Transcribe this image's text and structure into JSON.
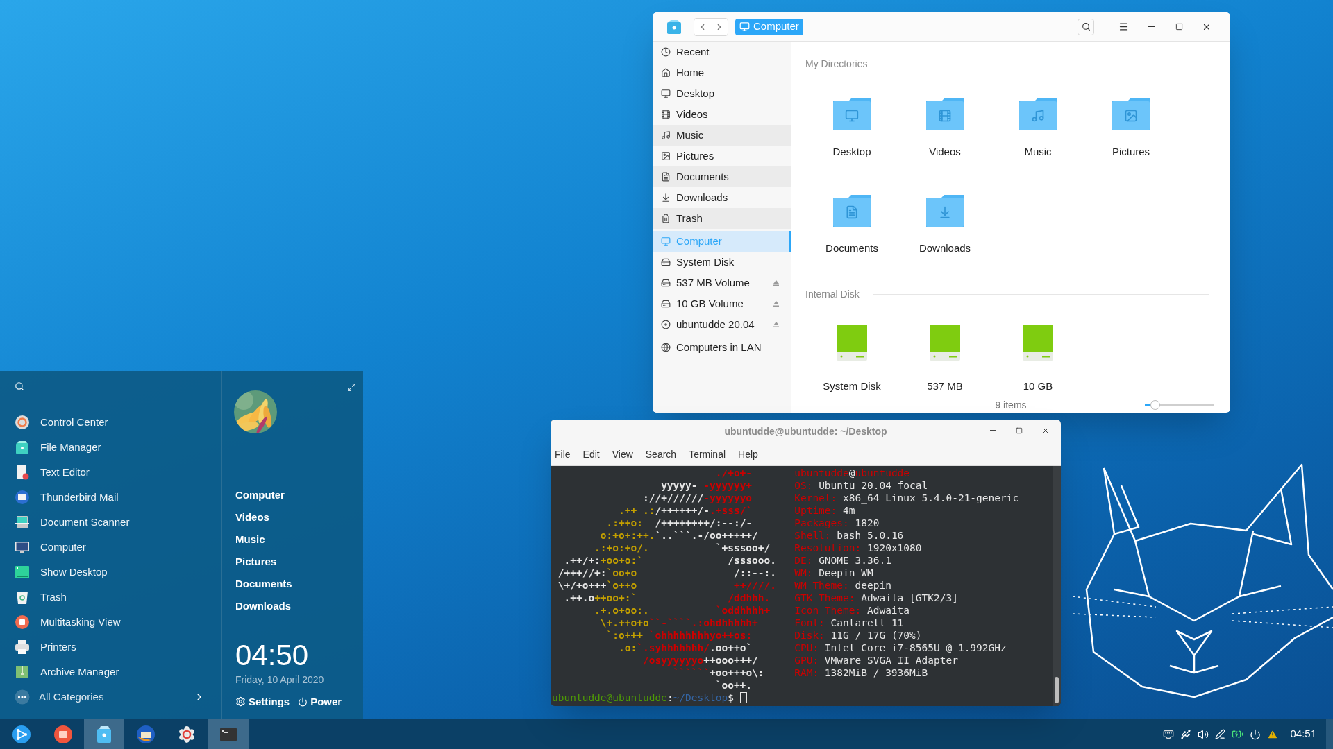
{
  "file_manager": {
    "breadcrumb": "Computer",
    "sidebar": {
      "groups": [
        [
          {
            "label": "Recent",
            "selected": false,
            "highlighted": false
          },
          {
            "label": "Home",
            "selected": false,
            "highlighted": false
          },
          {
            "label": "Desktop",
            "selected": false,
            "highlighted": false
          },
          {
            "label": "Videos",
            "selected": false,
            "highlighted": false
          },
          {
            "label": "Music",
            "selected": false,
            "highlighted": true
          },
          {
            "label": "Pictures",
            "selected": false,
            "highlighted": false
          },
          {
            "label": "Documents",
            "selected": false,
            "highlighted": true
          },
          {
            "label": "Downloads",
            "selected": false,
            "highlighted": false
          },
          {
            "label": "Trash",
            "selected": false,
            "highlighted": true
          }
        ],
        [
          {
            "label": "Computer",
            "selected": true,
            "highlighted": false,
            "ejectable": false
          },
          {
            "label": "System Disk",
            "selected": false,
            "highlighted": false,
            "ejectable": false
          },
          {
            "label": "537 MB Volume",
            "selected": false,
            "highlighted": false,
            "ejectable": true
          },
          {
            "label": "10 GB Volume",
            "selected": false,
            "highlighted": false,
            "ejectable": true
          },
          {
            "label": "ubuntudde 20.04",
            "selected": false,
            "highlighted": false,
            "ejectable": true
          }
        ],
        [
          {
            "label": "Computers in LAN",
            "selected": false,
            "highlighted": false
          }
        ]
      ]
    },
    "sections": [
      {
        "title": "My Directories",
        "kind": "folder",
        "items": [
          {
            "label": "Desktop"
          },
          {
            "label": "Videos"
          },
          {
            "label": "Music"
          },
          {
            "label": "Pictures"
          },
          {
            "label": "Documents"
          },
          {
            "label": "Downloads"
          }
        ]
      },
      {
        "title": "Internal Disk",
        "kind": "disk",
        "items": [
          {
            "label": "System Disk"
          },
          {
            "label": "537 MB"
          },
          {
            "label": "10 GB"
          }
        ]
      }
    ],
    "status": "9 items",
    "zoom": {
      "level": 0.15
    }
  },
  "terminal": {
    "title": "ubuntudde@ubuntudde: ~/Desktop",
    "menu": [
      "File",
      "Edit",
      "View",
      "Search",
      "Terminal",
      "Help"
    ],
    "lines": [
      {
        "art": [
          {
            "text": "                           ./+o+-",
            "color": "#cc0000"
          }
        ],
        "info": [
          {
            "text": "ubuntudde",
            "color": "#cc0000"
          },
          {
            "text": "@",
            "color": "#e6e6e6"
          },
          {
            "text": "ubuntudde",
            "color": "#cc0000"
          }
        ]
      },
      {
        "art": [
          {
            "text": "                  yyyyy- ",
            "color": "#e6e6e6"
          },
          {
            "text": "-yyyyyy+",
            "color": "#cc0000"
          }
        ],
        "info": [
          {
            "text": "OS:",
            "color": "#cc0000"
          },
          {
            "text": " Ubuntu 20.04 focal",
            "color": "#e6e6e6"
          }
        ]
      },
      {
        "art": [
          {
            "text": "               ://+//////",
            "color": "#e6e6e6"
          },
          {
            "text": "-yyyyyyo",
            "color": "#cc0000"
          }
        ],
        "info": [
          {
            "text": "Kernel:",
            "color": "#cc0000"
          },
          {
            "text": " x86_64 Linux 5.4.0-21-generic",
            "color": "#e6e6e6"
          }
        ]
      },
      {
        "art": [
          {
            "text": "           .++ .:",
            "color": "#c4a000"
          },
          {
            "text": "/++++++/-",
            "color": "#e6e6e6"
          },
          {
            "text": ".+sss/`",
            "color": "#cc0000"
          }
        ],
        "info": [
          {
            "text": "Uptime:",
            "color": "#cc0000"
          },
          {
            "text": " 4m",
            "color": "#e6e6e6"
          }
        ]
      },
      {
        "art": [
          {
            "text": "         .:++o:",
            "color": "#c4a000"
          },
          {
            "text": "  /++++++++/:--:/-",
            "color": "#e6e6e6"
          }
        ],
        "info": [
          {
            "text": "Packages:",
            "color": "#cc0000"
          },
          {
            "text": " 1820",
            "color": "#e6e6e6"
          }
        ]
      },
      {
        "art": [
          {
            "text": "        o:+o+:++.",
            "color": "#c4a000"
          },
          {
            "text": "`..```.-/oo+++++/",
            "color": "#e6e6e6"
          }
        ],
        "info": [
          {
            "text": "Shell:",
            "color": "#cc0000"
          },
          {
            "text": " bash 5.0.16",
            "color": "#e6e6e6"
          }
        ]
      },
      {
        "art": [
          {
            "text": "       .:+o:+o/.",
            "color": "#c4a000"
          },
          {
            "text": "           `+sssoo+/",
            "color": "#e6e6e6"
          }
        ],
        "info": [
          {
            "text": "Resolution:",
            "color": "#cc0000"
          },
          {
            "text": " 1920x1080",
            "color": "#e6e6e6"
          }
        ]
      },
      {
        "art": [
          {
            "text": "  .++/+:",
            "color": "#e6e6e6"
          },
          {
            "text": "+oo+o:`",
            "color": "#c4a000"
          },
          {
            "text": "              /sssooo.",
            "color": "#e6e6e6"
          }
        ],
        "info": [
          {
            "text": "DE:",
            "color": "#cc0000"
          },
          {
            "text": " GNOME 3.36.1",
            "color": "#e6e6e6"
          }
        ]
      },
      {
        "art": [
          {
            "text": " /+++//+:",
            "color": "#e6e6e6"
          },
          {
            "text": "`oo+o",
            "color": "#c4a000"
          },
          {
            "text": "                /::--:.",
            "color": "#e6e6e6"
          }
        ],
        "info": [
          {
            "text": "WM:",
            "color": "#cc0000"
          },
          {
            "text": " Deepin WM",
            "color": "#e6e6e6"
          }
        ]
      },
      {
        "art": [
          {
            "text": " \\+/+o+++",
            "color": "#e6e6e6"
          },
          {
            "text": "`o++o",
            "color": "#c4a000"
          },
          {
            "text": "                ++////.",
            "color": "#cc0000"
          }
        ],
        "info": [
          {
            "text": "WM Theme:",
            "color": "#cc0000"
          },
          {
            "text": " deepin",
            "color": "#e6e6e6"
          }
        ]
      },
      {
        "art": [
          {
            "text": "  .++.o",
            "color": "#e6e6e6"
          },
          {
            "text": "++oo+:`",
            "color": "#c4a000"
          },
          {
            "text": "               /ddhhh.",
            "color": "#cc0000"
          }
        ],
        "info": [
          {
            "text": "GTK Theme:",
            "color": "#cc0000"
          },
          {
            "text": " Adwaita [GTK2/3]",
            "color": "#e6e6e6"
          }
        ]
      },
      {
        "art": [
          {
            "text": "       .+.o+oo:.",
            "color": "#c4a000"
          },
          {
            "text": "           `oddhhhh+",
            "color": "#cc0000"
          }
        ],
        "info": [
          {
            "text": "Icon Theme:",
            "color": "#cc0000"
          },
          {
            "text": " Adwaita",
            "color": "#e6e6e6"
          }
        ]
      },
      {
        "art": [
          {
            "text": "        \\+.++o+o",
            "color": "#c4a000"
          },
          {
            "text": "``-````.:ohdhhhhh+",
            "color": "#cc0000"
          }
        ],
        "info": [
          {
            "text": "Font:",
            "color": "#cc0000"
          },
          {
            "text": " Cantarell 11",
            "color": "#e6e6e6"
          }
        ]
      },
      {
        "art": [
          {
            "text": "         `:o+++",
            "color": "#c4a000"
          },
          {
            "text": " `ohhhhhhhhyo++os:",
            "color": "#cc0000"
          }
        ],
        "info": [
          {
            "text": "Disk:",
            "color": "#cc0000"
          },
          {
            "text": " 11G / 17G (70%)",
            "color": "#e6e6e6"
          }
        ]
      },
      {
        "art": [
          {
            "text": "           .o:",
            "color": "#c4a000"
          },
          {
            "text": "`.syhhhhhhh/",
            "color": "#cc0000"
          },
          {
            "text": ".oo++o`",
            "color": "#e6e6e6"
          }
        ],
        "info": [
          {
            "text": "CPU:",
            "color": "#cc0000"
          },
          {
            "text": " Intel Core i7-8565U @ 1.992GHz",
            "color": "#e6e6e6"
          }
        ]
      },
      {
        "art": [
          {
            "text": "               /osyyyyyyo",
            "color": "#cc0000"
          },
          {
            "text": "++ooo+++/",
            "color": "#e6e6e6"
          }
        ],
        "info": [
          {
            "text": "GPU:",
            "color": "#cc0000"
          },
          {
            "text": " VMware SVGA II Adapter",
            "color": "#e6e6e6"
          }
        ]
      },
      {
        "art": [
          {
            "text": "                    ``````",
            "color": "#cc0000"
          },
          {
            "text": "+oo+++o\\:",
            "color": "#e6e6e6"
          }
        ],
        "info": [
          {
            "text": "RAM:",
            "color": "#cc0000"
          },
          {
            "text": " 1382MiB / 3936MiB",
            "color": "#e6e6e6"
          }
        ]
      },
      {
        "art": [
          {
            "text": "                           `oo++.",
            "color": "#e6e6e6"
          }
        ]
      }
    ],
    "prompt": [
      {
        "text": "ubuntudde@ubuntudde",
        "color": "#4e9a06"
      },
      {
        "text": ":",
        "color": "#e6e6e6"
      },
      {
        "text": "~/Desktop",
        "color": "#3465a4"
      },
      {
        "text": "$",
        "color": "#e6e6e6"
      }
    ]
  },
  "start_menu": {
    "apps": [
      {
        "label": "Control Center"
      },
      {
        "label": "File Manager"
      },
      {
        "label": "Text Editor"
      },
      {
        "label": "Thunderbird Mail"
      },
      {
        "label": "Document Scanner"
      },
      {
        "label": "Computer"
      },
      {
        "label": "Show Desktop"
      },
      {
        "label": "Trash"
      },
      {
        "label": "Multitasking View"
      },
      {
        "label": "Printers"
      },
      {
        "label": "Archive Manager"
      }
    ],
    "all_categories": "All Categories",
    "places": [
      "Computer",
      "Videos",
      "Music",
      "Pictures",
      "Documents",
      "Downloads"
    ],
    "time": "04:50",
    "date": "Friday, 10 April 2020",
    "settings": "Settings",
    "power": "Power"
  },
  "taskbar": {
    "apps": [
      {
        "active": false
      },
      {
        "active": false
      },
      {
        "active": true
      },
      {
        "active": false
      },
      {
        "active": false
      },
      {
        "active": true
      }
    ],
    "time": "04:51"
  }
}
